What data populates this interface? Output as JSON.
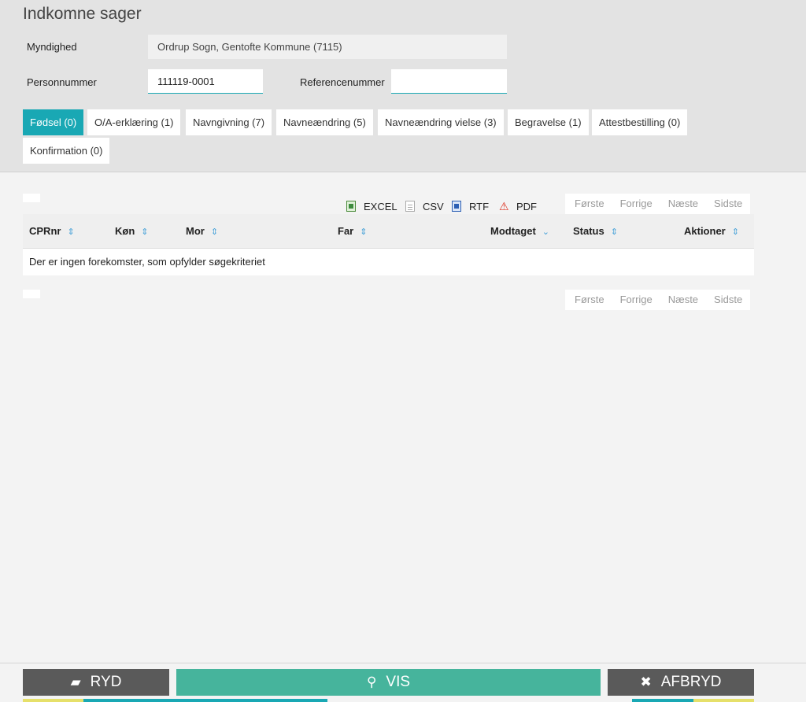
{
  "page_title": "Indkomne sager",
  "form": {
    "myndighed_label": "Myndighed",
    "myndighed_value": "Ordrup Sogn, Gentofte Kommune (7115)",
    "personnummer_label": "Personnummer",
    "personnummer_value": "111119-0001",
    "referencenummer_label": "Referencenummer",
    "referencenummer_value": ""
  },
  "tabs": [
    {
      "label": "Fødsel (0)",
      "active": true
    },
    {
      "label": "O/A-erklæring (1)",
      "active": false
    },
    {
      "label": "Navngivning (7)",
      "active": false
    },
    {
      "label": "Navneændring (5)",
      "active": false
    },
    {
      "label": "Navneændring vielse (3)",
      "active": false
    },
    {
      "label": "Begravelse (1)",
      "active": false
    },
    {
      "label": "Attestbestilling (0)",
      "active": false
    },
    {
      "label": "Konfirmation (0)",
      "active": false
    }
  ],
  "export": {
    "excel": "EXCEL",
    "csv": "CSV",
    "rtf": "RTF",
    "pdf": "PDF"
  },
  "pager": {
    "first": "Første",
    "prev": "Forrige",
    "next": "Næste",
    "last": "Sidste"
  },
  "table": {
    "columns": [
      "CPRnr",
      "Køn",
      "Mor",
      "Far",
      "Modtaget",
      "Status",
      "Aktioner"
    ],
    "empty_message": "Der er ingen forekomster, som opfylder søgekriteriet"
  },
  "buttons": {
    "ryd": "RYD",
    "vis": "VIS",
    "afbryd": "AFBRYD"
  },
  "colors": {
    "accent": "#19a8b4",
    "primary_button": "#46b49c",
    "secondary_button": "#5a5a5a",
    "sort_icon": "#4aa3d9"
  }
}
